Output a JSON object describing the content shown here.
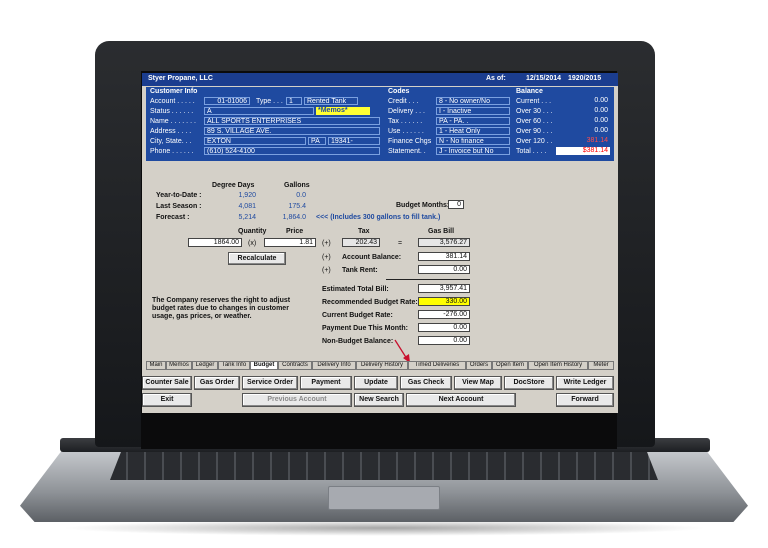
{
  "app": {
    "company": "Styer Propane, LLC",
    "as_of_label": "As of:",
    "as_of_date": "12/15/2014",
    "fiscal": "1920/2015"
  },
  "customer": {
    "title": "Customer Info",
    "account_label": "Account . . . . .",
    "account": "01-01006",
    "type_label": "Type . . .",
    "type_code": "1",
    "type_name": "Rented Tank",
    "status_label": "Status . . . . . .",
    "status": "A",
    "memo": "*Memos*",
    "name_label": "Name . . . . . . .",
    "name": "ALL SPORTS ENTERPRISES",
    "address_label": "Address . . . .",
    "address": "89 S. VILLAGE AVE.",
    "city_label": "City, State. . .",
    "city": "EXTON",
    "state": "PA",
    "zip": "19341-",
    "phone_label": "Phone . . . . . .",
    "phone": "(610) 524-4100"
  },
  "codes": {
    "title": "Codes",
    "items": [
      {
        "label": "Credit . . .",
        "value": "8 - No owner/No"
      },
      {
        "label": "Delivery . . .",
        "value": "I - Inactive"
      },
      {
        "label": "Tax . . . . . .",
        "value": "PA - PA. ."
      },
      {
        "label": "Use . . . . . .",
        "value": "1 - Heat Only"
      },
      {
        "label": "Finance Chgs",
        "value": "N - No finance"
      },
      {
        "label": "Statement. .",
        "value": "J - Invoice but No"
      }
    ]
  },
  "balance": {
    "title": "Balance",
    "items": [
      {
        "label": "Current . . .",
        "value": "0.00"
      },
      {
        "label": "Over 30 . . .",
        "value": "0.00"
      },
      {
        "label": "Over 60 . . .",
        "value": "0.00"
      },
      {
        "label": "Over 90 . . .",
        "value": "0.00"
      },
      {
        "label": "Over 120 . .",
        "value": "381.14"
      },
      {
        "label": "Total . . . .",
        "value": "$381.14"
      }
    ]
  },
  "budget": {
    "degree_days_label": "Degree Days",
    "gallons_label": "Gallons",
    "ytd_label": "Year-to-Date :",
    "ytd_dd": "1,920",
    "ytd_gal": "0.0",
    "last_label": "Last Season :",
    "last_dd": "4,081",
    "last_gal": "175.4",
    "forecast_label": "Forecast :",
    "fc_dd": "5,214",
    "fc_gal": "1,864.0",
    "fc_note": "<<< (Includes 300 gallons to fill tank.)",
    "budget_months_label": "Budget Months:",
    "budget_months": "0",
    "quantity_label": "Quantity",
    "price_label": "Price",
    "tax_label": "Tax",
    "gas_bill_label": "Gas Bill",
    "quantity": "1864.00",
    "x_sym": "(x)",
    "price": "1.81",
    "plus": "(+)",
    "tax": "202.43",
    "eq": "=",
    "gas_bill": "3,576.27",
    "recalc": "Recalculate",
    "acct_bal_label": "Account Balance:",
    "acct_bal": "381.14",
    "tank_rent_label": "Tank Rent:",
    "tank_rent": "0.00",
    "note": "The Company reserves the right to adjust budget rates due to changes in customer usage, gas prices, or weather.",
    "est_total_label": "Estimated Total Bill:",
    "est_total": "3,957.41",
    "rec_rate_label": "Recommended Budget Rate:",
    "rec_rate": "330.00",
    "cur_rate_label": "Current Budget Rate:",
    "cur_rate": "-276.00",
    "pay_due_label": "Payment Due This Month:",
    "pay_due": "0.00",
    "nonbudget_label": "Non-Budget Balance:",
    "nonbudget": "0.00"
  },
  "tabs": [
    "Main",
    "Memos",
    "Ledger",
    "Tank Info",
    "Budget",
    "Contracts",
    "Delivery Info",
    "Delivery History",
    "Timed Deliveries",
    "Orders",
    "Open Item",
    "Open Item History",
    "Meter"
  ],
  "actions_row1": [
    "Counter Sale",
    "Gas Order",
    "Service Order",
    "Payment",
    "Update",
    "Gas Check",
    "View Map",
    "DocStore",
    "Write Ledger"
  ],
  "actions_row2": [
    "Exit",
    "Previous Account",
    "New Search",
    "Next Account",
    "Forward"
  ]
}
